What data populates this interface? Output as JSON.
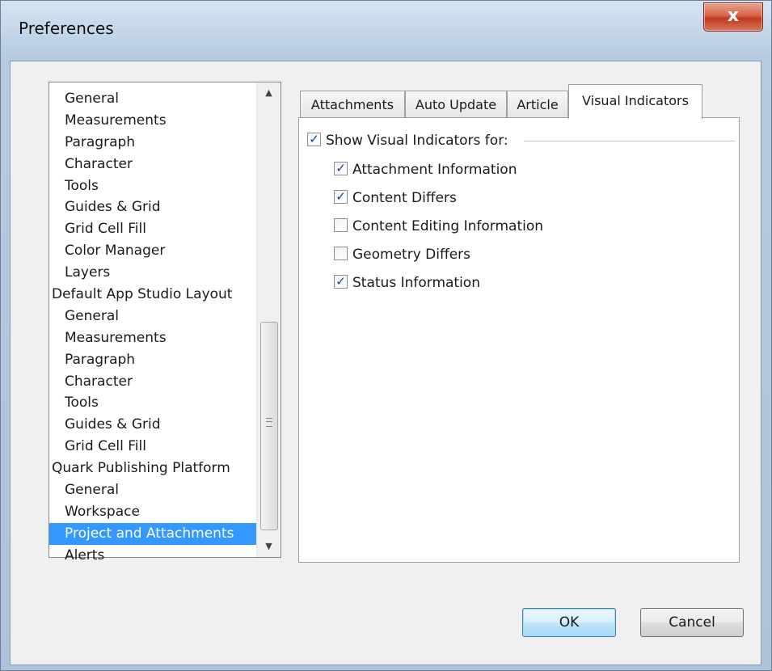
{
  "window": {
    "title": "Preferences",
    "close_label": "x"
  },
  "preferences_list": {
    "items": [
      {
        "label": "General",
        "level": 1,
        "selected": false
      },
      {
        "label": "Measurements",
        "level": 1,
        "selected": false
      },
      {
        "label": "Paragraph",
        "level": 1,
        "selected": false
      },
      {
        "label": "Character",
        "level": 1,
        "selected": false
      },
      {
        "label": "Tools",
        "level": 1,
        "selected": false
      },
      {
        "label": "Guides & Grid",
        "level": 1,
        "selected": false
      },
      {
        "label": "Grid Cell Fill",
        "level": 1,
        "selected": false
      },
      {
        "label": "Color Manager",
        "level": 1,
        "selected": false
      },
      {
        "label": "Layers",
        "level": 1,
        "selected": false
      },
      {
        "label": "Default App Studio Layout",
        "level": 0,
        "selected": false
      },
      {
        "label": "General",
        "level": 1,
        "selected": false
      },
      {
        "label": "Measurements",
        "level": 1,
        "selected": false
      },
      {
        "label": "Paragraph",
        "level": 1,
        "selected": false
      },
      {
        "label": "Character",
        "level": 1,
        "selected": false
      },
      {
        "label": "Tools",
        "level": 1,
        "selected": false
      },
      {
        "label": "Guides & Grid",
        "level": 1,
        "selected": false
      },
      {
        "label": "Grid Cell Fill",
        "level": 1,
        "selected": false
      },
      {
        "label": "Quark Publishing Platform",
        "level": 0,
        "selected": false
      },
      {
        "label": "General",
        "level": 1,
        "selected": false
      },
      {
        "label": "Workspace",
        "level": 1,
        "selected": false
      },
      {
        "label": "Project and Attachments",
        "level": 1,
        "selected": true
      },
      {
        "label": "Alerts",
        "level": 1,
        "selected": false
      }
    ],
    "scroll_up_icon": "▲",
    "scroll_down_icon": "▼"
  },
  "tabs": [
    {
      "label": "Attachments",
      "active": false
    },
    {
      "label": "Auto Update",
      "active": false
    },
    {
      "label": "Article",
      "active": false
    },
    {
      "label": "Visual Indicators",
      "active": true
    }
  ],
  "visual_indicators": {
    "show_label": "Show Visual Indicators for:",
    "show_checked": true,
    "options": [
      {
        "label": "Attachment Information",
        "checked": true
      },
      {
        "label": "Content Differs",
        "checked": true
      },
      {
        "label": "Content Editing Information",
        "checked": false
      },
      {
        "label": "Geometry Differs",
        "checked": false
      },
      {
        "label": "Status Information",
        "checked": true
      }
    ]
  },
  "buttons": {
    "ok_label": "OK",
    "cancel_label": "Cancel"
  },
  "colors": {
    "selection": "#3399ff",
    "check_mark": "#1c3f8f",
    "close_button": "#c0391d"
  }
}
